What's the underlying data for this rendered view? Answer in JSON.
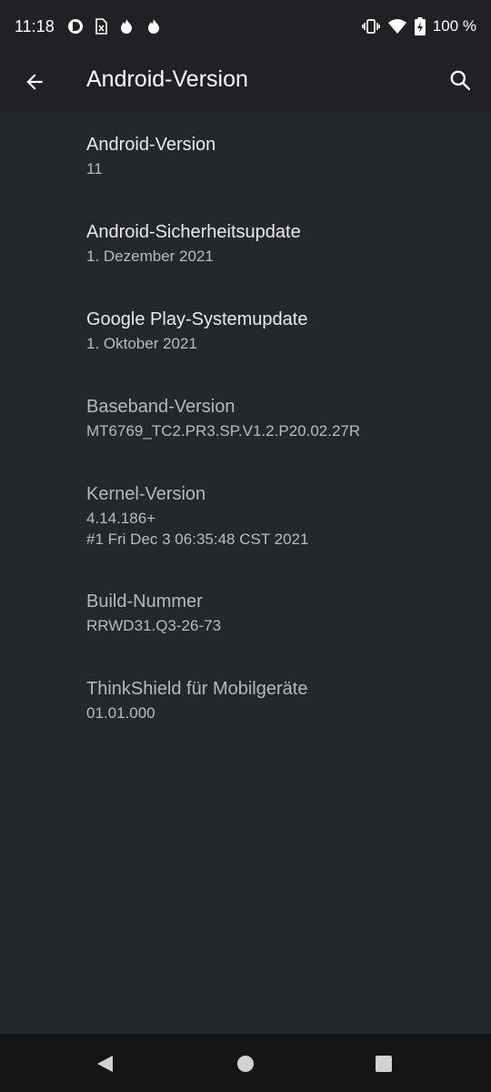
{
  "status_bar": {
    "time": "11:18",
    "battery": "100 %"
  },
  "app_bar": {
    "title": "Android-Version"
  },
  "items": [
    {
      "title": "Android-Version",
      "summary": "11",
      "summary2": ""
    },
    {
      "title": "Android-Sicherheitsupdate",
      "summary": "1. Dezember 2021",
      "summary2": ""
    },
    {
      "title": "Google Play-Systemupdate",
      "summary": "1. Oktober 2021",
      "summary2": ""
    },
    {
      "title": "Baseband-Version",
      "summary": "MT6769_TC2.PR3.SP.V1.2.P20.02.27R",
      "summary2": ""
    },
    {
      "title": "Kernel-Version",
      "summary": "4.14.186+",
      "summary2": "#1 Fri Dec 3 06:35:48 CST 2021"
    },
    {
      "title": "Build-Nummer",
      "summary": "RRWD31.Q3-26-73",
      "summary2": ""
    },
    {
      "title": "ThinkShield für Mobilgeräte",
      "summary": "01.01.000",
      "summary2": ""
    }
  ],
  "icons": {
    "back": "arrow-back-icon",
    "search": "search-icon",
    "nav_back": "triangle-back-icon",
    "nav_home": "circle-home-icon",
    "nav_recents": "square-recents-icon"
  }
}
